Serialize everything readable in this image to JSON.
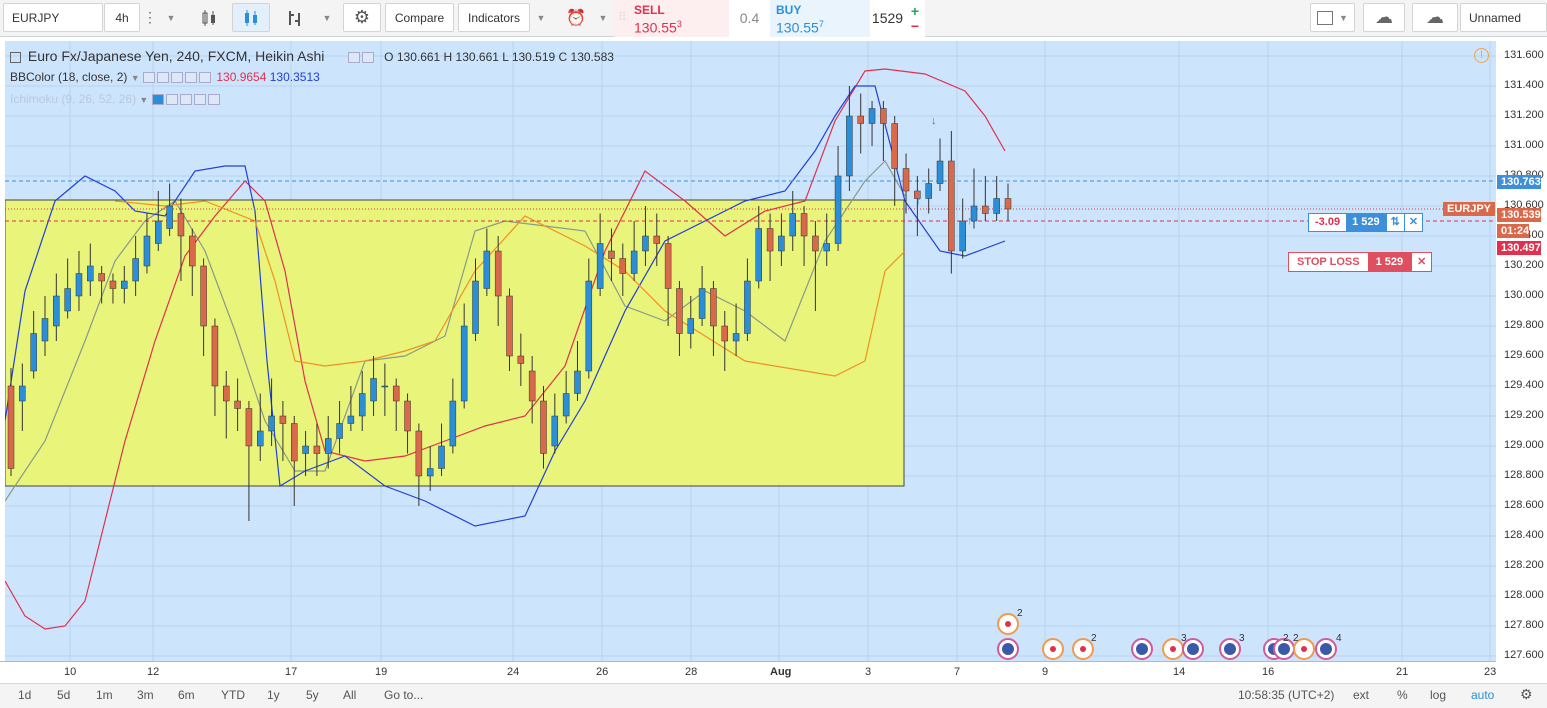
{
  "toolbar": {
    "symbol": "EURJPY",
    "interval": "4h",
    "compare_label": "Compare",
    "indicators_label": "Indicators",
    "layout_name": "Unnamed"
  },
  "trade": {
    "sell_label": "SELL",
    "sell_price_main": "130.55",
    "sell_price_sup": "3",
    "spread": "0.4",
    "buy_label": "BUY",
    "buy_price_main": "130.55",
    "buy_price_sup": "7",
    "quantity": "1529",
    "plus": "+",
    "minus": "−"
  },
  "legend": {
    "title": "Euro Fx/Japanese Yen, 240, FXCM, Heikin Ashi",
    "ohlc": "O 130.661  H 130.661  L 130.519  C 130.583",
    "bb_name": "BBColor (18, close, 2)",
    "bb_val1": "130.9654",
    "bb_val2": "130.3513",
    "ichimoku_name": "Ichimoku (9, 26, 52, 26)"
  },
  "position": {
    "pnl": "-3.09",
    "qty": "1 529",
    "reverse_icon": "⇅",
    "close_icon": "✕"
  },
  "stop_loss": {
    "label": "STOP LOSS",
    "qty": "1 529",
    "close_icon": "✕"
  },
  "price_axis": {
    "ticks": [
      "131.600",
      "131.400",
      "131.200",
      "131.000",
      "130.800",
      "130.600",
      "130.400",
      "130.200",
      "130.000",
      "129.800",
      "129.600",
      "129.400",
      "129.200",
      "129.000",
      "128.800",
      "128.600",
      "128.400",
      "128.200",
      "128.000",
      "127.800",
      "127.600"
    ],
    "pos_label": "130.763",
    "symbol_label": "EURJPY",
    "last_label": "130.539",
    "countdown": "01:24",
    "sl_label": "130.497"
  },
  "time_axis": {
    "ticks": [
      "10",
      "12",
      "17",
      "19",
      "24",
      "26",
      "28",
      "Aug",
      "3",
      "7",
      "9",
      "14",
      "16",
      "21",
      "23"
    ]
  },
  "bottom": {
    "ranges": [
      "1d",
      "5d",
      "1m",
      "3m",
      "6m",
      "YTD",
      "1y",
      "5y",
      "All"
    ],
    "goto": "Go to...",
    "clock": "10:58:35 (UTC+2)",
    "ext": "ext",
    "pct": "%",
    "log": "log",
    "auto": "auto"
  },
  "events": {
    "badges": [
      "2",
      "2",
      "3",
      "3",
      "2",
      "2",
      "4"
    ]
  },
  "colors": {
    "chart_bg": "#cde4fd",
    "box_fill": "#e9f47a",
    "up_candle": "#2a8fd8",
    "down_candle": "#d9694a",
    "bb_upper": "#e0304e",
    "bb_lower": "#2040d8",
    "sell": "#e0304e",
    "buy": "#2c8fd9"
  },
  "chart_data": {
    "type": "candlestick",
    "title": "Euro Fx/Japanese Yen, 240, FXCM, Heikin Ashi",
    "ylim": [
      127.55,
      131.7
    ],
    "grid": true,
    "candles": [
      [
        129.4,
        128.85,
        129.52,
        128.8
      ],
      [
        129.3,
        129.4,
        129.55,
        129.1
      ],
      [
        129.5,
        129.75,
        129.9,
        129.45
      ],
      [
        129.7,
        129.85,
        130.0,
        129.6
      ],
      [
        129.8,
        130.0,
        130.15,
        129.7
      ],
      [
        129.9,
        130.05,
        130.25,
        129.85
      ],
      [
        130.0,
        130.15,
        130.3,
        129.9
      ],
      [
        130.1,
        130.2,
        130.35,
        130.0
      ],
      [
        130.15,
        130.1,
        130.2,
        129.95
      ],
      [
        130.1,
        130.05,
        130.15,
        129.95
      ],
      [
        130.05,
        130.1,
        130.2,
        129.95
      ],
      [
        130.1,
        130.25,
        130.4,
        130.0
      ],
      [
        130.2,
        130.4,
        130.55,
        130.15
      ],
      [
        130.35,
        130.5,
        130.7,
        130.3
      ],
      [
        130.45,
        130.6,
        130.75,
        130.4
      ],
      [
        130.55,
        130.4,
        130.65,
        130.1
      ],
      [
        130.4,
        130.2,
        130.45,
        130.0
      ],
      [
        130.2,
        129.8,
        130.25,
        129.6
      ],
      [
        129.8,
        129.4,
        129.85,
        129.2
      ],
      [
        129.4,
        129.3,
        129.5,
        129.05
      ],
      [
        129.3,
        129.25,
        129.45,
        129.1
      ],
      [
        129.25,
        129.0,
        129.3,
        128.5
      ],
      [
        129.0,
        129.1,
        129.35,
        128.9
      ],
      [
        129.1,
        129.2,
        129.45,
        129.0
      ],
      [
        129.2,
        129.15,
        129.3,
        128.9
      ],
      [
        129.15,
        128.9,
        129.2,
        128.6
      ],
      [
        128.95,
        129.0,
        129.1,
        128.8
      ],
      [
        129.0,
        128.95,
        129.15,
        128.8
      ],
      [
        128.95,
        129.05,
        129.2,
        128.85
      ],
      [
        129.05,
        129.15,
        129.3,
        128.95
      ],
      [
        129.15,
        129.2,
        129.4,
        129.1
      ],
      [
        129.2,
        129.35,
        129.5,
        129.1
      ],
      [
        129.3,
        129.45,
        129.6,
        129.2
      ],
      [
        129.4,
        129.4,
        129.55,
        129.2
      ],
      [
        129.4,
        129.3,
        129.45,
        129.1
      ],
      [
        129.3,
        129.1,
        129.35,
        128.95
      ],
      [
        129.1,
        128.8,
        129.15,
        128.6
      ],
      [
        128.8,
        128.85,
        129.0,
        128.7
      ],
      [
        128.85,
        129.0,
        129.15,
        128.8
      ],
      [
        129.0,
        129.3,
        129.45,
        128.95
      ],
      [
        129.3,
        129.8,
        129.95,
        129.25
      ],
      [
        129.75,
        130.1,
        130.25,
        129.7
      ],
      [
        130.05,
        130.3,
        130.45,
        130.0
      ],
      [
        130.3,
        130.0,
        130.4,
        129.8
      ],
      [
        130.0,
        129.6,
        130.05,
        129.5
      ],
      [
        129.6,
        129.55,
        129.75,
        129.4
      ],
      [
        129.5,
        129.3,
        129.6,
        129.15
      ],
      [
        129.3,
        128.95,
        129.4,
        128.85
      ],
      [
        129.0,
        129.2,
        129.35,
        128.95
      ],
      [
        129.2,
        129.35,
        129.5,
        129.15
      ],
      [
        129.35,
        129.5,
        129.7,
        129.3
      ],
      [
        129.5,
        130.1,
        130.25,
        129.45
      ],
      [
        130.05,
        130.35,
        130.55,
        130.0
      ],
      [
        130.3,
        130.25,
        130.45,
        130.1
      ],
      [
        130.25,
        130.15,
        130.35,
        130.0
      ],
      [
        130.15,
        130.3,
        130.5,
        130.1
      ],
      [
        130.3,
        130.4,
        130.6,
        130.2
      ],
      [
        130.4,
        130.35,
        130.55,
        130.2
      ],
      [
        130.35,
        130.05,
        130.4,
        129.8
      ],
      [
        130.05,
        129.75,
        130.1,
        129.6
      ],
      [
        129.75,
        129.85,
        130.0,
        129.65
      ],
      [
        129.85,
        130.05,
        130.2,
        129.8
      ],
      [
        130.05,
        129.8,
        130.1,
        129.6
      ],
      [
        129.8,
        129.7,
        129.9,
        129.5
      ],
      [
        129.7,
        129.75,
        129.95,
        129.6
      ],
      [
        129.75,
        130.1,
        130.25,
        129.7
      ],
      [
        130.1,
        130.45,
        130.6,
        130.05
      ],
      [
        130.45,
        130.3,
        130.55,
        130.1
      ],
      [
        130.3,
        130.4,
        130.55,
        130.2
      ],
      [
        130.4,
        130.55,
        130.7,
        130.3
      ],
      [
        130.55,
        130.4,
        130.6,
        130.2
      ],
      [
        130.4,
        130.3,
        130.5,
        129.9
      ],
      [
        130.3,
        130.35,
        130.55,
        130.2
      ],
      [
        130.35,
        130.8,
        131.0,
        130.3
      ],
      [
        130.8,
        131.2,
        131.4,
        130.7
      ],
      [
        131.2,
        131.15,
        131.35,
        130.95
      ],
      [
        131.15,
        131.25,
        131.3,
        131.0
      ],
      [
        131.25,
        131.15,
        131.3,
        130.9
      ],
      [
        131.15,
        130.85,
        131.2,
        130.6
      ],
      [
        130.85,
        130.7,
        130.95,
        130.55
      ],
      [
        130.7,
        130.65,
        130.8,
        130.4
      ],
      [
        130.65,
        130.75,
        130.85,
        130.55
      ],
      [
        130.75,
        130.9,
        131.05,
        130.7
      ],
      [
        130.9,
        130.3,
        131.1,
        130.15
      ],
      [
        130.3,
        130.5,
        130.65,
        130.25
      ],
      [
        130.5,
        130.6,
        130.85,
        130.45
      ],
      [
        130.6,
        130.55,
        130.8,
        130.5
      ],
      [
        130.55,
        130.65,
        130.8,
        130.5
      ],
      [
        130.65,
        130.58,
        130.75,
        130.5
      ]
    ]
  }
}
